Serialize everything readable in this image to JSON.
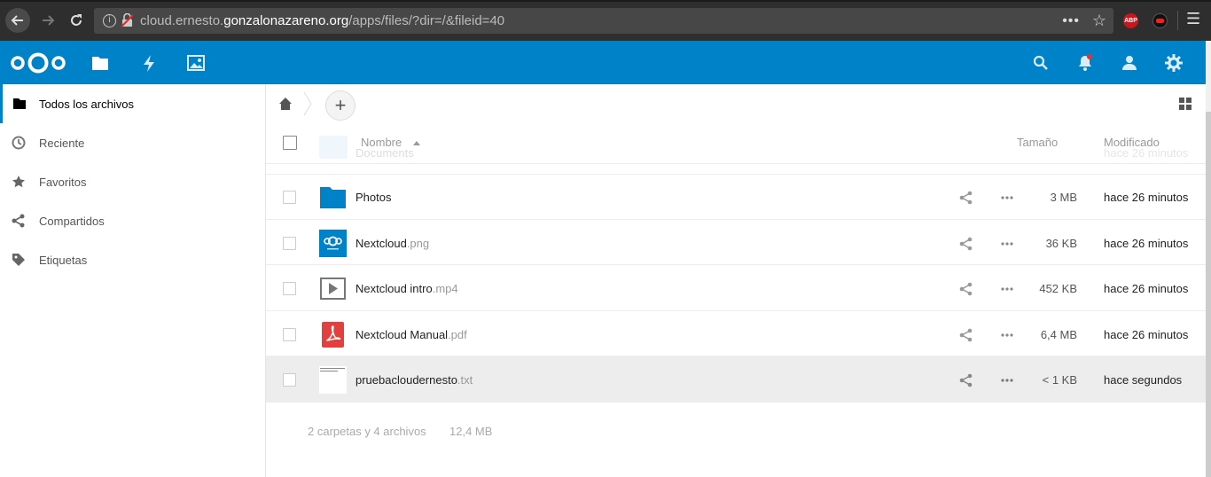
{
  "browser": {
    "url_prefix": "cloud.ernesto.",
    "url_domain": "gonzalonazareno.org",
    "url_path": "/apps/files/?dir=/&fileid=40",
    "url_dots": "•••",
    "abp_label": "ABP"
  },
  "header": {
    "icons": [
      "files-icon",
      "activity-icon",
      "gallery-icon",
      "search-icon",
      "notifications-icon",
      "contacts-icon",
      "settings-icon"
    ],
    "accent_color": "#0082c9"
  },
  "sidebar": {
    "items": [
      {
        "label": "Todos los archivos",
        "icon": "folder-icon",
        "active": true
      },
      {
        "label": "Reciente",
        "icon": "clock-icon",
        "active": false
      },
      {
        "label": "Favoritos",
        "icon": "star-icon",
        "active": false
      },
      {
        "label": "Compartidos",
        "icon": "share-icon",
        "active": false
      },
      {
        "label": "Etiquetas",
        "icon": "tag-icon",
        "active": false
      }
    ]
  },
  "toolbar": {
    "add_label": "+"
  },
  "table": {
    "col_name": "Nombre",
    "col_size": "Tamaño",
    "col_modified": "Modificado",
    "ghost_name": "Documents",
    "ghost_modified": "hace 26 minutos",
    "rows": [
      {
        "name": "Photos",
        "ext": "",
        "size": "3 MB",
        "modified": "hace 26 minutos",
        "type": "folder"
      },
      {
        "name": "Nextcloud",
        "ext": ".png",
        "size": "36 KB",
        "modified": "hace 26 minutos",
        "type": "image"
      },
      {
        "name": "Nextcloud intro",
        "ext": ".mp4",
        "size": "452 KB",
        "modified": "hace 26 minutos",
        "type": "video"
      },
      {
        "name": "Nextcloud Manual",
        "ext": ".pdf",
        "size": "6,4 MB",
        "modified": "hace 26 minutos",
        "type": "pdf"
      },
      {
        "name": "pruebacloudernesto",
        "ext": ".txt",
        "size": "< 1 KB",
        "modified": "hace segundos",
        "type": "text"
      }
    ]
  },
  "summary": {
    "counts": "2 carpetas y 4 archivos",
    "total_size": "12,4 MB"
  }
}
